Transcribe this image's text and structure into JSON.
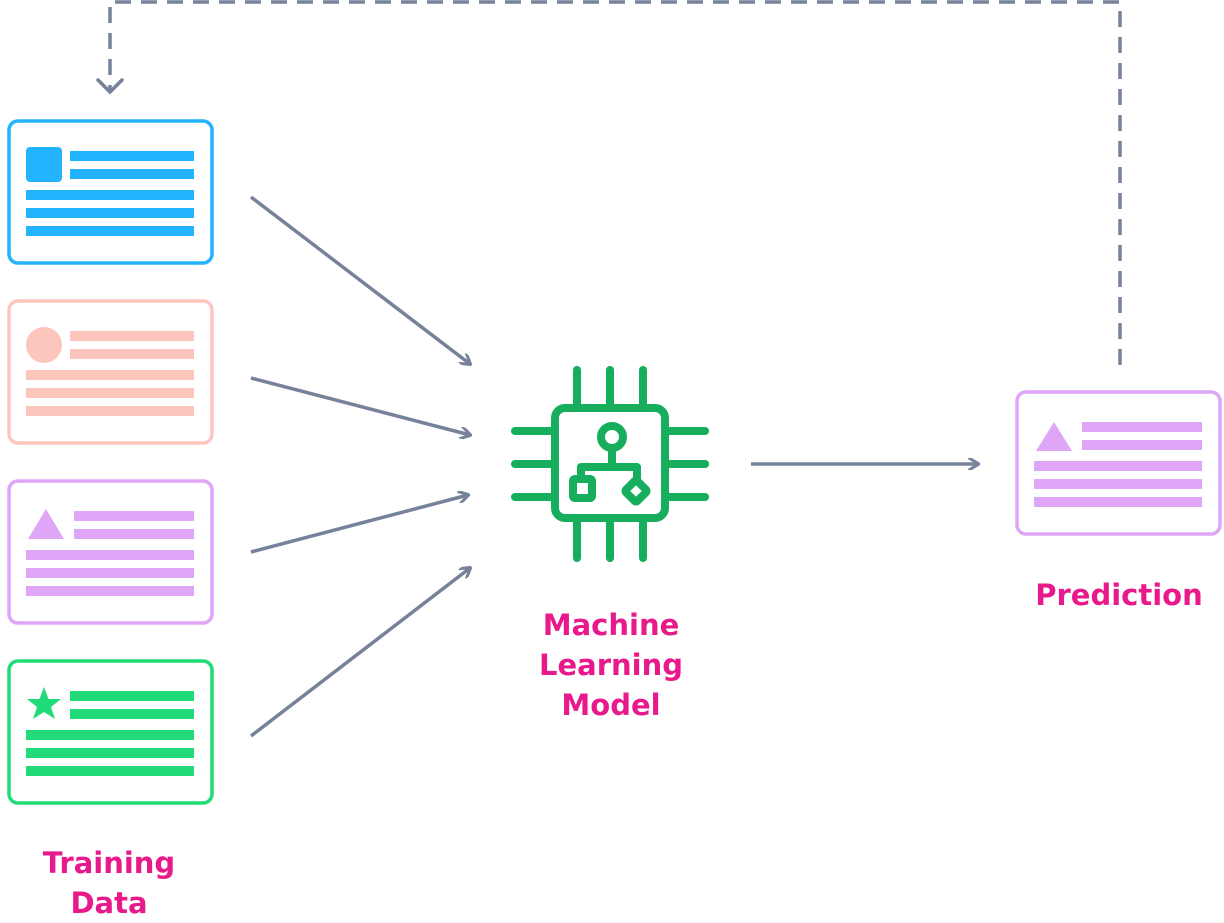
{
  "labels": {
    "training_data": "Training Data",
    "model_line1": "Machine",
    "model_line2": "Learning",
    "model_line3": "Model",
    "prediction": "Prediction"
  },
  "colors": {
    "label": "#e8198b",
    "arrow": "#76819a",
    "chip": "#16ad5c",
    "card_blue": "#24b4ff",
    "card_salmon": "#fdc6bd",
    "card_purple": "#dfa5f7",
    "card_green": "#20db77"
  },
  "cards": [
    {
      "icon": "square-icon",
      "color": "card_blue"
    },
    {
      "icon": "circle-icon",
      "color": "card_salmon"
    },
    {
      "icon": "triangle-icon",
      "color": "card_purple"
    },
    {
      "icon": "star-icon",
      "color": "card_green"
    }
  ],
  "prediction_card": {
    "icon": "triangle-icon",
    "color": "card_purple"
  }
}
